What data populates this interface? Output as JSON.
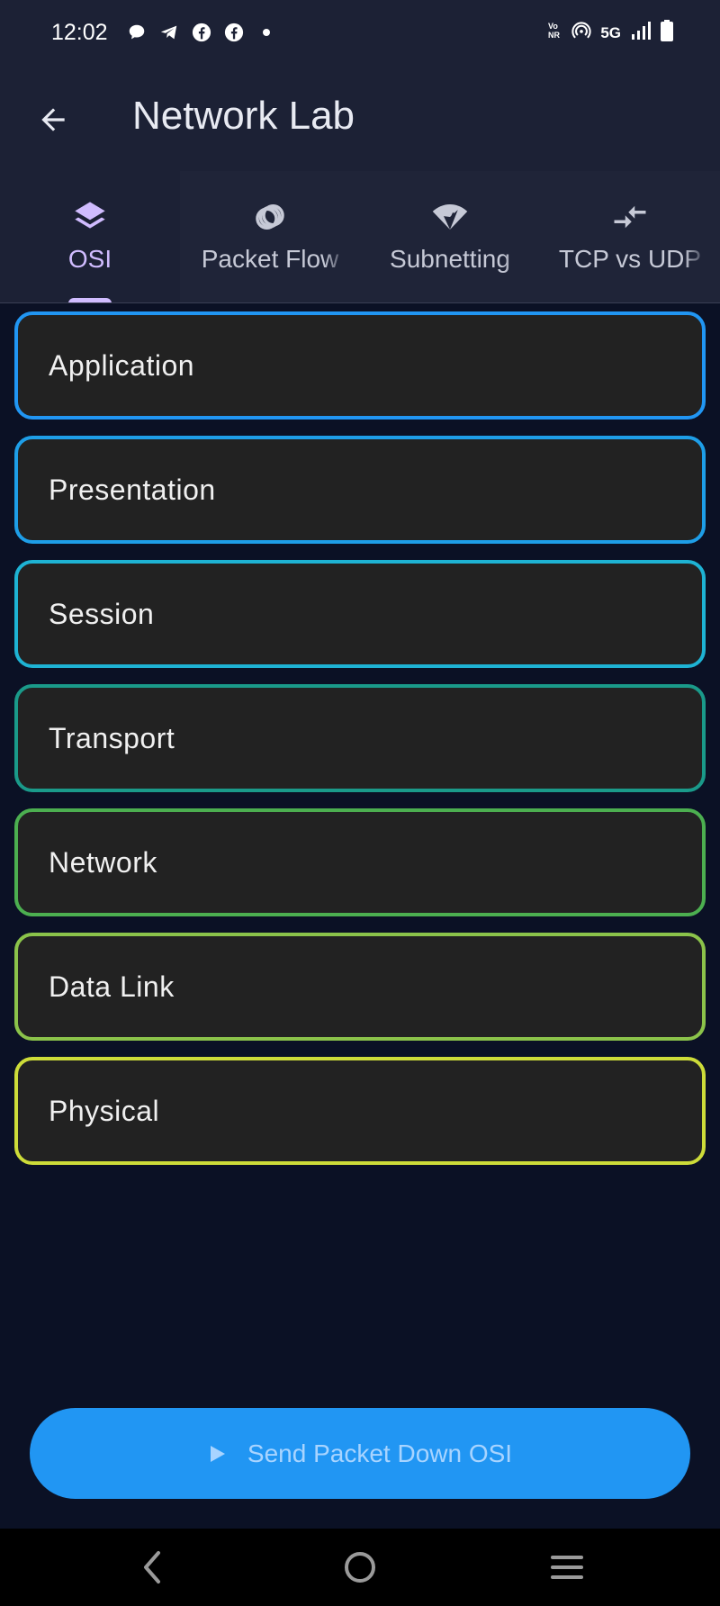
{
  "status_bar": {
    "time": "12:02",
    "network_label": "5G",
    "icons": [
      "chat-bubble-icon",
      "telegram-icon",
      "facebook-icon",
      "facebook-icon",
      "dot-icon",
      "volte-icon",
      "hotspot-icon",
      "signal-icon",
      "battery-icon"
    ]
  },
  "app_bar": {
    "title": "Network Lab",
    "back_icon": "arrow-back-icon"
  },
  "tabs": [
    {
      "label": "OSI",
      "icon": "layers-icon",
      "active": true
    },
    {
      "label": "Packet Flow",
      "icon": "rings-icon",
      "active": false
    },
    {
      "label": "Subnetting",
      "icon": "wifi-icon",
      "active": false
    },
    {
      "label": "TCP vs UDP",
      "icon": "compare-arrows-icon",
      "active": false
    }
  ],
  "layers": [
    {
      "label": "Application",
      "color": "#2196f3"
    },
    {
      "label": "Presentation",
      "color": "#1e9ee8"
    },
    {
      "label": "Session",
      "color": "#1eb3d4"
    },
    {
      "label": "Transport",
      "color": "#1a9a8a"
    },
    {
      "label": "Network",
      "color": "#4caf50"
    },
    {
      "label": "Data Link",
      "color": "#8bc34a"
    },
    {
      "label": "Physical",
      "color": "#cddc39"
    }
  ],
  "send_button": {
    "label": "Send Packet Down OSI",
    "icon": "play-icon",
    "color": "#2196f3"
  },
  "nav_bar": {
    "icons": [
      "nav-back-icon",
      "nav-home-icon",
      "nav-recents-icon"
    ]
  }
}
